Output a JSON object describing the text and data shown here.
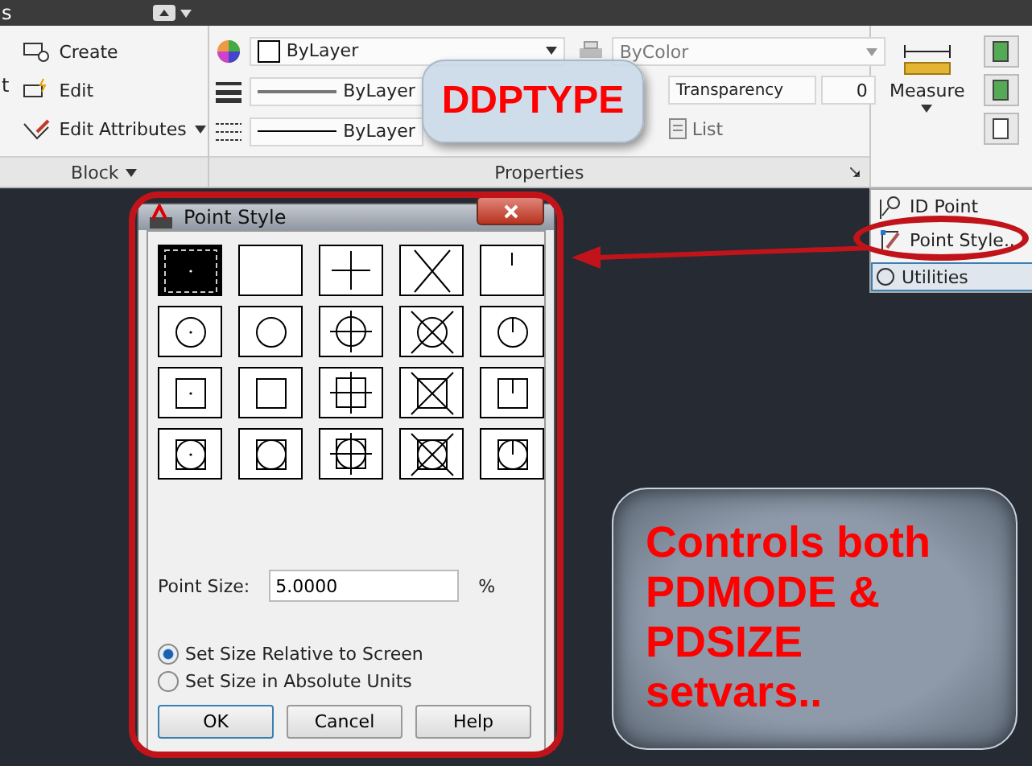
{
  "top_bar": {
    "menu_fragment": "s"
  },
  "ribbon": {
    "block_panel": {
      "large_button_fragment": "t",
      "items": [
        {
          "label": "Create",
          "kind": "create"
        },
        {
          "label": "Edit",
          "kind": "edit"
        },
        {
          "label": "Edit Attributes",
          "kind": "attributes"
        }
      ],
      "title": "Block"
    },
    "properties_panel": {
      "color_value": "ByLayer",
      "lineweight": "ByLayer",
      "linetype": "ByLayer",
      "plot_style": "ByColor",
      "transparency_label": "Transparency",
      "transparency_value": "0",
      "list": "List",
      "title": "Properties"
    },
    "measure_panel": {
      "label": "Measure"
    },
    "utilities_menu": {
      "items": [
        {
          "label": "ID Point",
          "kind": "id"
        },
        {
          "label": "Point Style...",
          "kind": "style"
        }
      ],
      "panel_title": "Utilities"
    }
  },
  "dialog": {
    "title": "Point Style",
    "styles": [
      {
        "kind": "dot",
        "selected": true
      },
      {
        "kind": "blank",
        "selected": false
      },
      {
        "kind": "plus",
        "selected": false
      },
      {
        "kind": "cross",
        "selected": false
      },
      {
        "kind": "tick",
        "selected": false
      },
      {
        "kind": "circle-dot",
        "selected": false
      },
      {
        "kind": "circle",
        "selected": false
      },
      {
        "kind": "circle-plus",
        "selected": false
      },
      {
        "kind": "circle-cross",
        "selected": false
      },
      {
        "kind": "circle-tick",
        "selected": false
      },
      {
        "kind": "square-dot",
        "selected": false
      },
      {
        "kind": "square",
        "selected": false
      },
      {
        "kind": "square-plus",
        "selected": false
      },
      {
        "kind": "square-cross",
        "selected": false
      },
      {
        "kind": "square-tick",
        "selected": false
      },
      {
        "kind": "square-circle-dot",
        "selected": false
      },
      {
        "kind": "square-circle",
        "selected": false
      },
      {
        "kind": "square-circle-plus",
        "selected": false
      },
      {
        "kind": "square-circle-cross",
        "selected": false
      },
      {
        "kind": "square-circle-tick",
        "selected": false
      }
    ],
    "point_size_label": "Point Size:",
    "point_size": "5.0000",
    "unit": "%",
    "options": [
      {
        "label": "Set Size Relative to Screen",
        "selected": true
      },
      {
        "label": "Set Size in Absolute Units",
        "selected": false
      }
    ],
    "buttons": [
      "OK",
      "Cancel",
      "Help"
    ]
  },
  "annotations": {
    "command": "DDPTYPE",
    "note": "Controls both PDMODE & PDSIZE setvars.."
  }
}
